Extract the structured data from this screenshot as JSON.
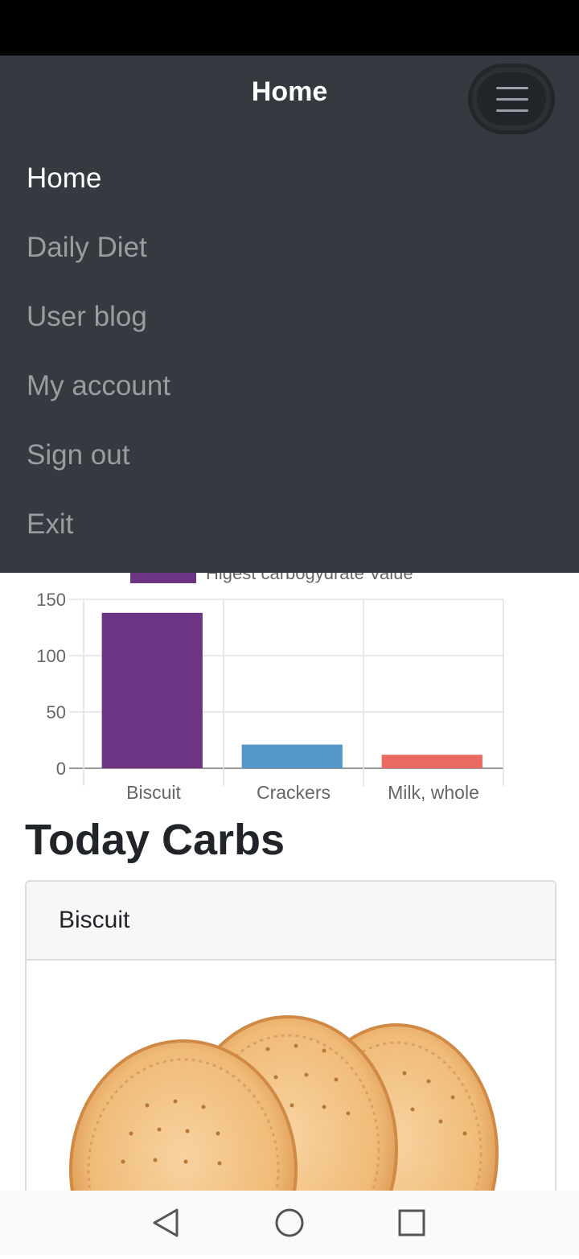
{
  "navbar": {
    "title": "Home",
    "menu": [
      {
        "label": "Home",
        "active": true
      },
      {
        "label": "Daily Diet",
        "active": false
      },
      {
        "label": "User blog",
        "active": false
      },
      {
        "label": "My account",
        "active": false
      },
      {
        "label": "Sign out",
        "active": false
      },
      {
        "label": "Exit",
        "active": false
      }
    ]
  },
  "chart_data": {
    "type": "bar",
    "categories": [
      "Biscuit",
      "Crackers",
      "Milk, whole"
    ],
    "series": [
      {
        "name": "Higest carbogydrate Value",
        "values": [
          138,
          21,
          12
        ],
        "colors": [
          "#6d3484",
          "#5597c9",
          "#ea6a62"
        ]
      }
    ],
    "ylim": [
      0,
      150
    ],
    "yticks": [
      0,
      50,
      100,
      150
    ],
    "grid": true,
    "legend": "top"
  },
  "main": {
    "section_title": "Today Carbs",
    "card": {
      "header": "Biscuit",
      "image": "biscuits-image"
    }
  },
  "system_nav": {
    "icons": [
      "back-icon",
      "home-icon",
      "recents-icon"
    ]
  }
}
